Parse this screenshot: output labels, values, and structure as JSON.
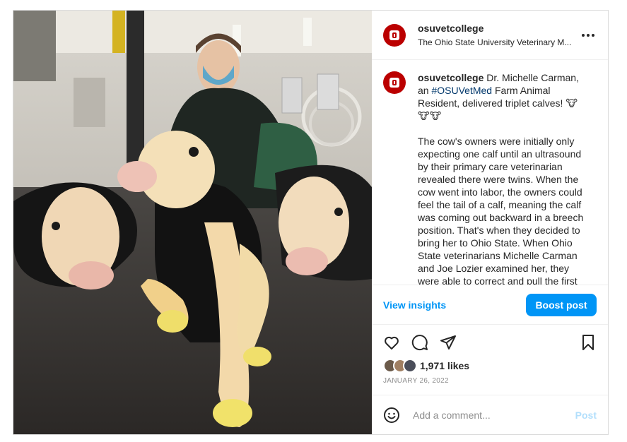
{
  "header": {
    "username": "osuvetcollege",
    "subtitle": "The Ohio State University Veterinary M...",
    "avatar_text": "The Ohio State University"
  },
  "caption": {
    "username": "osuvetcollege",
    "text_before_tag": " Dr. Michelle Carman, an ",
    "hashtag": "#OSUVetMed",
    "text_after_tag": " Farm Animal Resident, delivered triplet calves! ",
    "emojis": "🐮🐮🐮",
    "paragraph2": "The cow's owners were initially only expecting one calf until an ultrasound by their primary care veterinarian revealed there were twins. When the cow went into labor, the owners could feel the tail of a calf, meaning the calf was coming out backward in a breech position. That's when they decided to bring her to Ohio State. When Ohio State veterinarians Michelle Carman and Joe Lozier examined her, they were able to correct and pull the first calf as well as the second calf. When"
  },
  "insights": {
    "view_label": "View insights",
    "boost_label": "Boost post"
  },
  "engagement": {
    "likes": "1,971 likes",
    "date": "JANUARY 26, 2022"
  },
  "comment": {
    "placeholder": "Add a comment...",
    "post_label": "Post"
  },
  "colors": {
    "brand": "#bb0000",
    "link": "#0095f6",
    "hashtag": "#00376b"
  }
}
